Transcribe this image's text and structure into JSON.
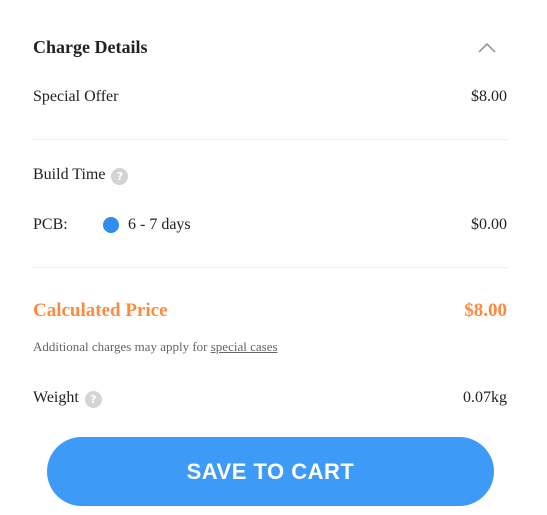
{
  "charge": {
    "title": "Charge Details",
    "collapse_icon": "chevron-up-icon",
    "special_offer_label": "Special Offer",
    "special_offer_value": "$8.00",
    "build_time_label": "Build Time",
    "help_icon": "question-circle-icon",
    "help_glyph": "?",
    "pcb_label": "PCB:",
    "pcb_option": "6 - 7 days",
    "pcb_value": "$0.00",
    "calculated_label": "Calculated Price",
    "calculated_value": "$8.00",
    "note_prefix": "Additional charges may apply for",
    "note_link": "special cases",
    "weight_label": "Weight",
    "weight_value": "0.07kg"
  },
  "actions": {
    "save_to_cart": "SAVE TO CART"
  },
  "colors": {
    "accent_orange": "#ff8a3d",
    "button_blue": "#3d9af7",
    "radio_blue": "#2f8cf0"
  }
}
